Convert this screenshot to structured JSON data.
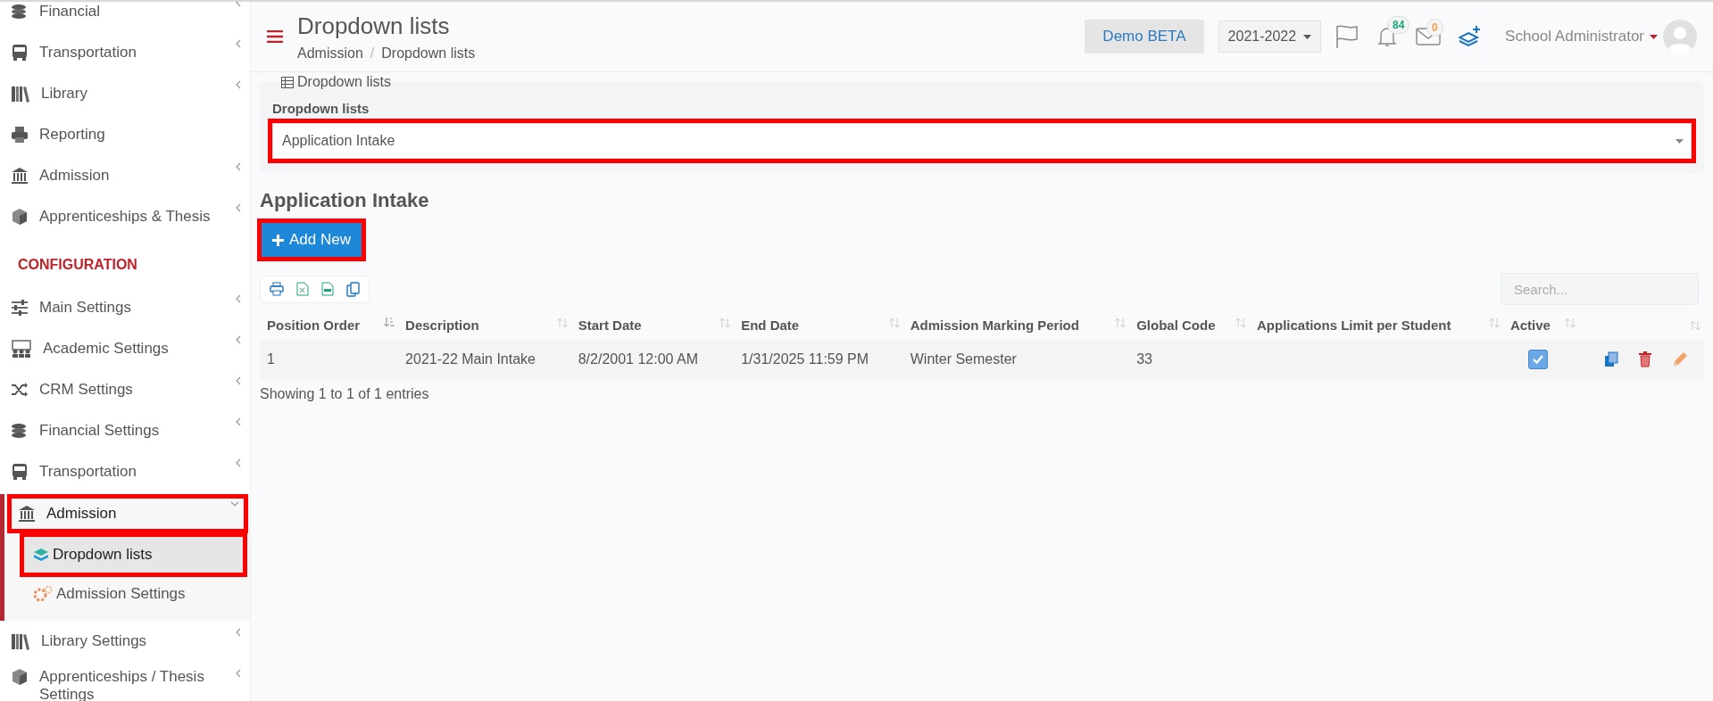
{
  "sidebar": {
    "items": [
      {
        "kind": "item",
        "label": "Financial",
        "submenu": true,
        "expanded": false
      },
      {
        "kind": "item",
        "label": "Transportation",
        "submenu": true,
        "expanded": false
      },
      {
        "kind": "item",
        "label": "Library",
        "submenu": true,
        "expanded": false
      },
      {
        "kind": "item",
        "label": "Reporting",
        "submenu": false
      },
      {
        "kind": "item",
        "label": "Admission",
        "submenu": true,
        "expanded": false
      },
      {
        "kind": "item",
        "label": "Apprenticeships & Thesis",
        "submenu": true,
        "expanded": false
      },
      {
        "kind": "section",
        "label": "CONFIGURATION"
      },
      {
        "kind": "item",
        "label": "Main Settings",
        "submenu": true,
        "expanded": false
      },
      {
        "kind": "item",
        "label": "Academic Settings",
        "submenu": true,
        "expanded": false
      },
      {
        "kind": "item",
        "label": "CRM Settings",
        "submenu": true,
        "expanded": false
      },
      {
        "kind": "item",
        "label": "Financial Settings",
        "submenu": true,
        "expanded": false
      },
      {
        "kind": "item",
        "label": "Transportation",
        "submenu": true,
        "expanded": false
      },
      {
        "kind": "item",
        "label": "Admission",
        "submenu": true,
        "expanded": true,
        "highlighted": true,
        "children": [
          {
            "label": "Dropdown lists",
            "selected": true,
            "highlighted": true
          },
          {
            "label": "Admission Settings",
            "selected": false,
            "highlighted": false
          }
        ]
      },
      {
        "kind": "item",
        "label": "Library Settings",
        "submenu": true,
        "expanded": false
      },
      {
        "kind": "item",
        "label": "Apprenticeships / Thesis Settings",
        "submenu": true,
        "expanded": false
      }
    ]
  },
  "header": {
    "title": "Dropdown lists",
    "breadcrumb": [
      "Admission",
      "Dropdown lists"
    ],
    "breadcrumb_separator": "/",
    "demo_button": "Demo BETA",
    "year": "2021-2022",
    "notifications": [
      {
        "kind": "bell",
        "count": "84",
        "color": "#1aa37a"
      },
      {
        "kind": "mail",
        "count": "0",
        "color": "#f0a04b"
      }
    ],
    "user": "School Administrator"
  },
  "panel": {
    "legend": "Dropdown lists",
    "field_label": "Dropdown lists",
    "select_value": "Application Intake",
    "highlighted": true
  },
  "section_title": "Application Intake",
  "add_button": {
    "label": "Add New",
    "highlighted": true
  },
  "search": {
    "placeholder": "Search..."
  },
  "table": {
    "columns": [
      {
        "label": "Position Order",
        "sorted": true
      },
      {
        "label": "Description",
        "sorted": false
      },
      {
        "label": "Start Date",
        "sorted": false
      },
      {
        "label": "End Date",
        "sorted": false
      },
      {
        "label": "Admission Marking Period",
        "sorted": false
      },
      {
        "label": "Global Code",
        "sorted": false
      },
      {
        "label": "Applications Limit per Student",
        "sorted": false
      },
      {
        "label": "Active",
        "sorted": false
      },
      {
        "sorted": false
      }
    ],
    "rows": [
      {
        "cells": [
          "1",
          "2021-22 Main Intake",
          "8/2/2001 12:00 AM",
          "1/31/2025 11:59 PM",
          "Winter Semester",
          "33"
        ],
        "active": true
      }
    ]
  },
  "footer": "Showing 1 to 1 of 1 entries"
}
